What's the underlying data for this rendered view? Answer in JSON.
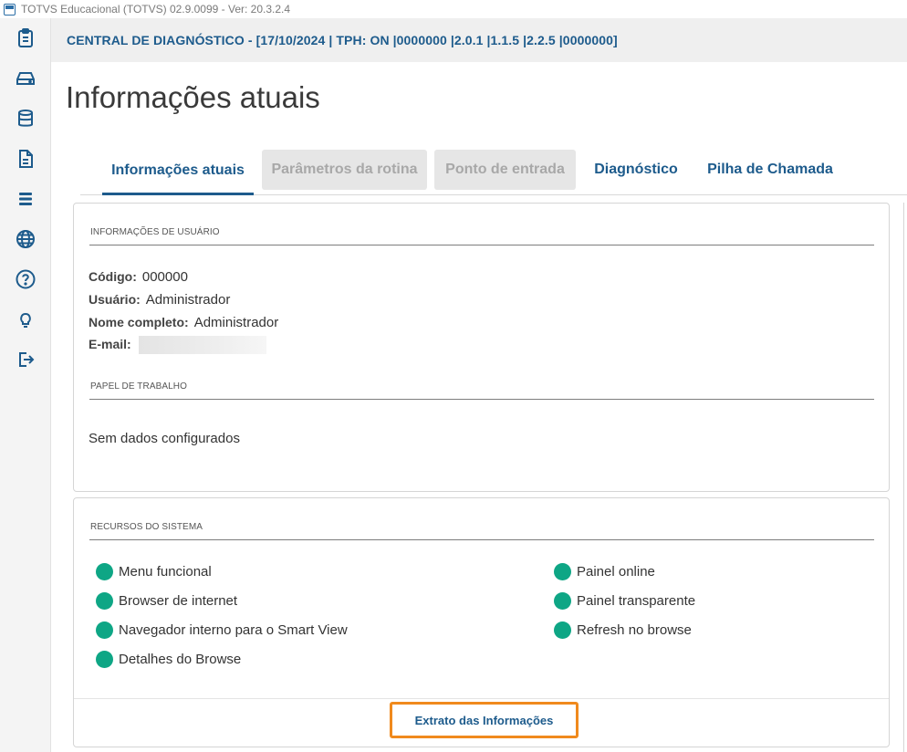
{
  "window": {
    "title": "TOTVS Educacional (TOTVS) 02.9.0099 - Ver: 20.3.2.4"
  },
  "sidebar": {
    "items": [
      {
        "icon": "clipboard-icon"
      },
      {
        "icon": "drive-icon"
      },
      {
        "icon": "database-icon"
      },
      {
        "icon": "document-icon"
      },
      {
        "icon": "server-icon"
      },
      {
        "icon": "globe-icon"
      },
      {
        "icon": "help-icon"
      },
      {
        "icon": "lightbulb-icon"
      },
      {
        "icon": "logout-icon"
      }
    ]
  },
  "header": {
    "text": "CENTRAL DE DIAGNÓSTICO - [17/10/2024 | TPH: ON |0000000 |2.0.1 |1.1.5 |2.2.5 |0000000]"
  },
  "page": {
    "title": "Informações atuais"
  },
  "tabs": [
    {
      "label": "Informações atuais",
      "state": "active"
    },
    {
      "label": "Parâmetros da rotina",
      "state": "disabled"
    },
    {
      "label": "Ponto de entrada",
      "state": "disabled"
    },
    {
      "label": "Diagnóstico",
      "state": "normal"
    },
    {
      "label": "Pilha de Chamada",
      "state": "normal"
    }
  ],
  "user_info": {
    "section_title": "INFORMAÇÕES DE USUÁRIO",
    "fields": [
      {
        "label": "Código:",
        "value": "000000"
      },
      {
        "label": "Usuário:",
        "value": "Administrador"
      },
      {
        "label": "Nome completo:",
        "value": "Administrador"
      },
      {
        "label": "E-mail:",
        "value": ""
      }
    ]
  },
  "work_role": {
    "section_title": "PAPEL DE TRABALHO",
    "empty_text": "Sem dados configurados"
  },
  "resources": {
    "section_title": "RECURSOS DO SISTEMA",
    "status_color": "#0ea685",
    "left": [
      "Menu funcional",
      "Browser de internet",
      "Navegador interno para o Smart View",
      "Detalhes do Browse"
    ],
    "right": [
      "Painel online",
      "Painel transparente",
      "Refresh no browse"
    ]
  },
  "actions": {
    "extract_label": "Extrato das Informações"
  },
  "colors": {
    "accent": "#1d5b8c",
    "highlight": "#f08a1d"
  }
}
